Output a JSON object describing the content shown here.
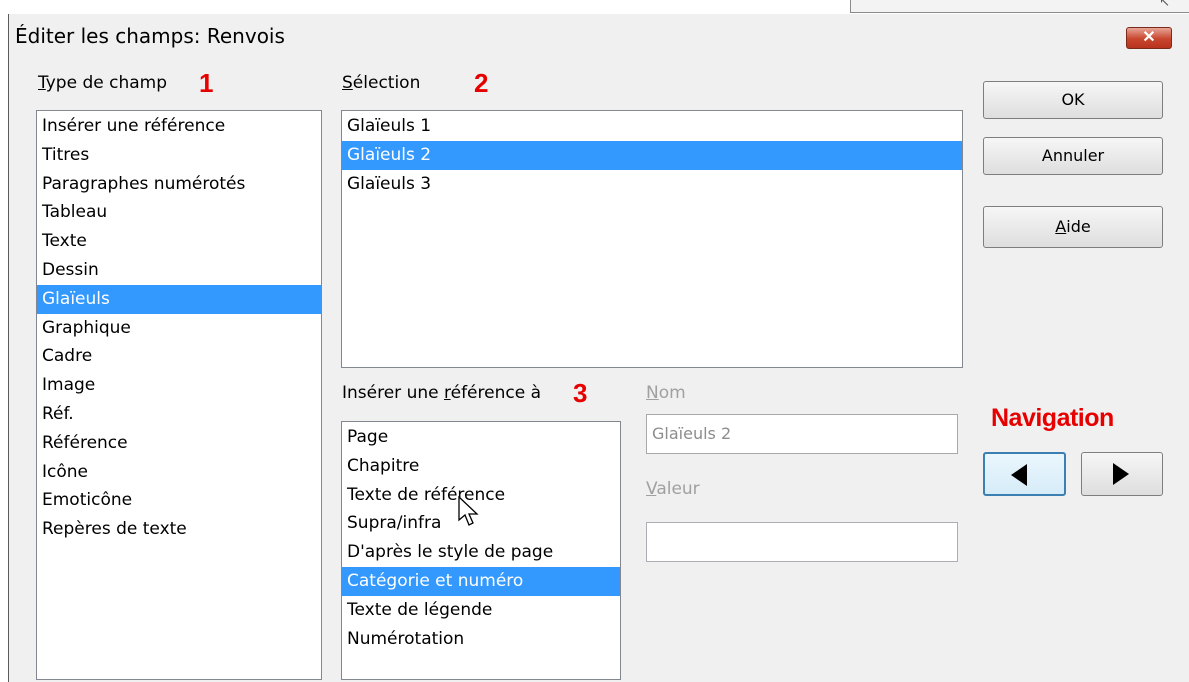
{
  "title": "Éditer les champs: Renvois",
  "close_glyph": "✕",
  "annotations": {
    "n1": "1",
    "n2": "2",
    "n3": "3",
    "navigation": "Navigation"
  },
  "type_champ": {
    "label": "Type de champ",
    "items": [
      "Insérer une référence",
      "Titres",
      "Paragraphes numérotés",
      "Tableau",
      "Texte",
      "Dessin",
      "Glaïeuls",
      "Graphique",
      "Cadre",
      "Image",
      "Réf.",
      "Référence",
      "Icône",
      "Emoticône",
      "Repères de texte"
    ],
    "selected": "Glaïeuls"
  },
  "selection": {
    "label": "Sélection",
    "items": [
      "Glaïeuls 1",
      "Glaïeuls 2",
      "Glaïeuls 3"
    ],
    "selected": "Glaïeuls 2"
  },
  "inserer_ref": {
    "label": "Insérer une référence à",
    "items": [
      "Page",
      "Chapitre",
      "Texte de référence",
      "Supra/infra",
      "D'après le style de page",
      "Catégorie et numéro",
      "Texte de légende",
      "Numérotation"
    ],
    "selected": "Catégorie et numéro"
  },
  "nom": {
    "label": "Nom",
    "value": "Glaïeuls 2"
  },
  "valeur": {
    "label": "Valeur",
    "value": ""
  },
  "buttons": {
    "ok": "OK",
    "annuler": "Annuler",
    "aide": "Aide"
  },
  "colors": {
    "selection": "#3399ff",
    "annotation": "#e60000",
    "close": "#c8452e"
  }
}
